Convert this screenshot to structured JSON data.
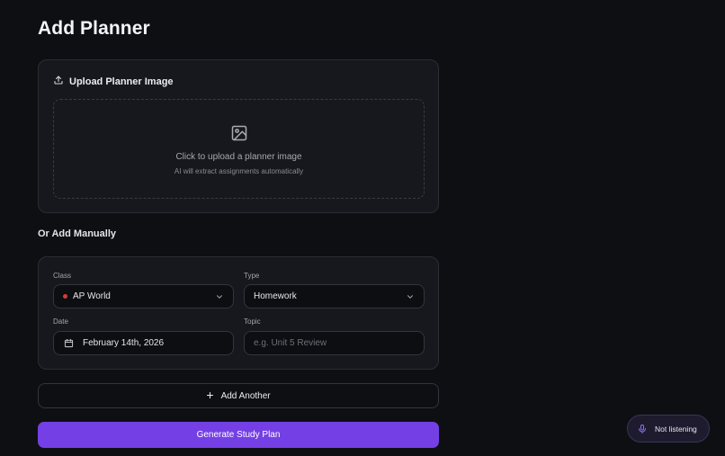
{
  "page": {
    "title": "Add Planner"
  },
  "upload": {
    "heading": "Upload Planner Image",
    "drop_main": "Click to upload a planner image",
    "drop_sub": "AI will extract assignments automatically"
  },
  "manual": {
    "section_title": "Or Add Manually",
    "class_label": "Class",
    "class_value": "AP World",
    "class_color": "#d83a3a",
    "type_label": "Type",
    "type_value": "Homework",
    "date_label": "Date",
    "date_value": "February 14th, 2026",
    "topic_label": "Topic",
    "topic_placeholder": "e.g. Unit 5 Review"
  },
  "actions": {
    "add_another": "Add Another",
    "generate": "Generate Study Plan",
    "accent": "#7440e6"
  },
  "voice": {
    "status": "Not listening",
    "icon": "microphone-icon"
  }
}
